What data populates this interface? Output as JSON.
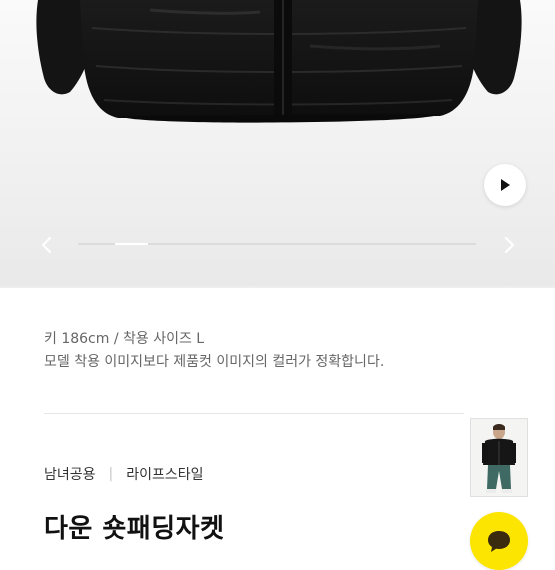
{
  "model_info": {
    "size_line": "키 186cm / 착용 사이즈 L",
    "notice_line": "모델 착용 이미지보다 제품컷 이미지의 컬러가 정확합니다."
  },
  "category": {
    "gender": "남녀공용",
    "style": "라이프스타일"
  },
  "product": {
    "name": "다운 숏패딩자켓"
  },
  "gallery": {
    "progress_fraction": 0.15
  },
  "icons": {
    "play": "play-icon",
    "prev": "chevron-left-icon",
    "next": "chevron-right-icon",
    "chat": "chat-bubble-icon"
  },
  "colors": {
    "chat_button": "#fce500",
    "jacket": "#151515"
  }
}
